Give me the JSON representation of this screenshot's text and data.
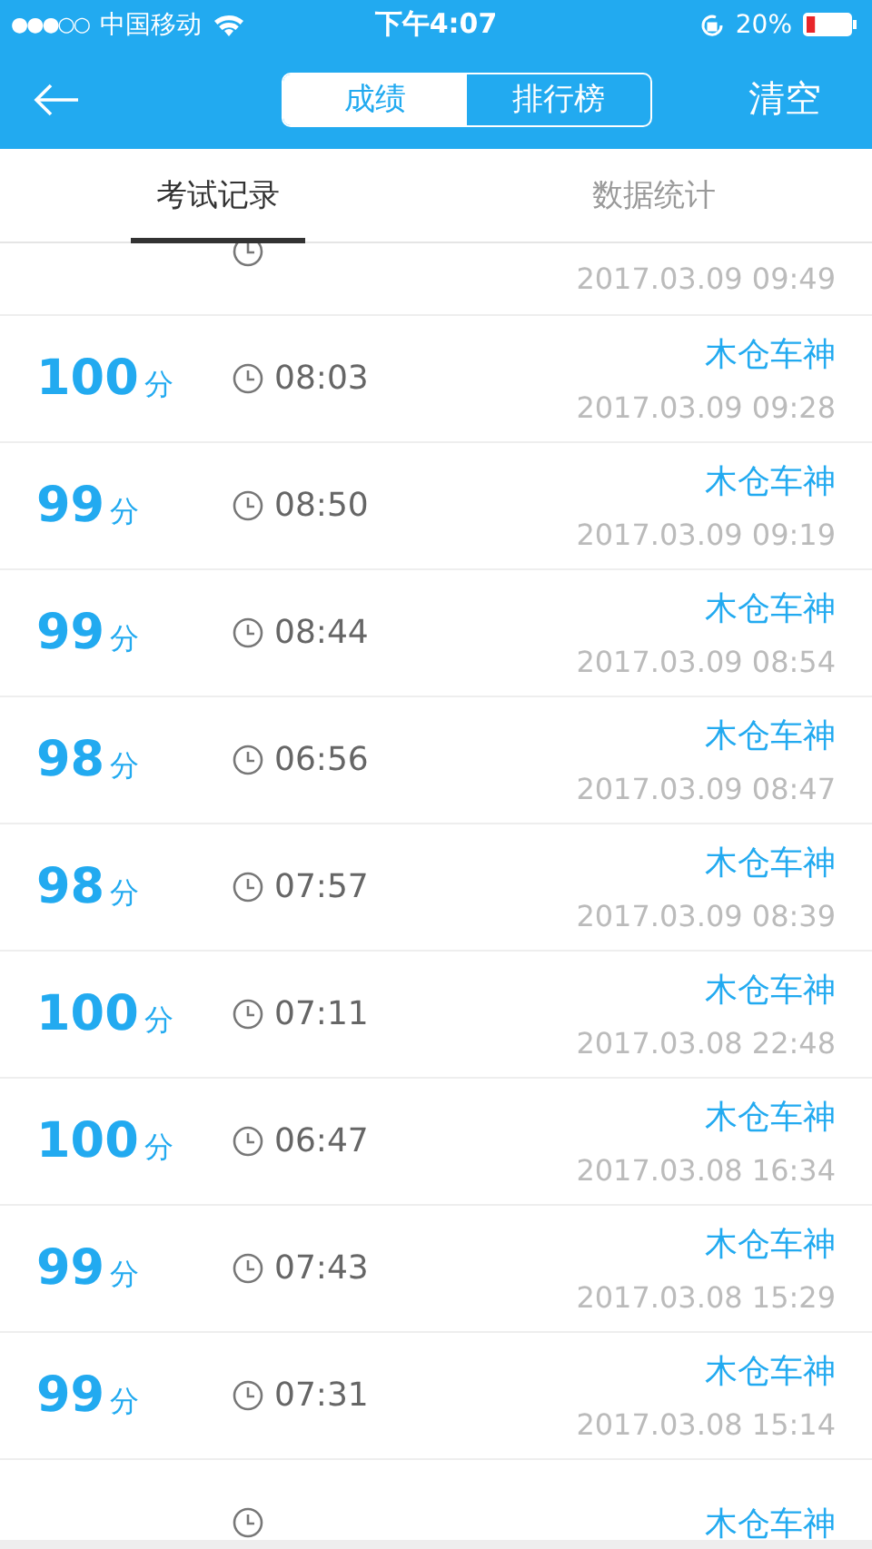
{
  "status_bar": {
    "signal": "●●●○○",
    "carrier": "中国移动",
    "time": "下午4:07",
    "battery": "20%"
  },
  "nav": {
    "segments": [
      {
        "label": "成绩",
        "selected": true
      },
      {
        "label": "排行榜",
        "selected": false
      }
    ],
    "action": "清空"
  },
  "tabs": [
    {
      "label": "考试记录",
      "selected": true
    },
    {
      "label": "数据统计",
      "selected": false
    }
  ],
  "records": [
    {
      "date": "2017.03.09 09:49"
    },
    {
      "score": "100",
      "unit": "分",
      "duration": "08:03",
      "name": "木仓车神",
      "date": "2017.03.09 09:28"
    },
    {
      "score": "99",
      "unit": "分",
      "duration": "08:50",
      "name": "木仓车神",
      "date": "2017.03.09 09:19"
    },
    {
      "score": "99",
      "unit": "分",
      "duration": "08:44",
      "name": "木仓车神",
      "date": "2017.03.09 08:54"
    },
    {
      "score": "98",
      "unit": "分",
      "duration": "06:56",
      "name": "木仓车神",
      "date": "2017.03.09 08:47"
    },
    {
      "score": "98",
      "unit": "分",
      "duration": "07:57",
      "name": "木仓车神",
      "date": "2017.03.09 08:39"
    },
    {
      "score": "100",
      "unit": "分",
      "duration": "07:11",
      "name": "木仓车神",
      "date": "2017.03.08 22:48"
    },
    {
      "score": "100",
      "unit": "分",
      "duration": "06:47",
      "name": "木仓车神",
      "date": "2017.03.08 16:34"
    },
    {
      "score": "99",
      "unit": "分",
      "duration": "07:43",
      "name": "木仓车神",
      "date": "2017.03.08 15:29"
    },
    {
      "score": "99",
      "unit": "分",
      "duration": "07:31",
      "name": "木仓车神",
      "date": "2017.03.08 15:14"
    },
    {
      "name": "木仓车神"
    }
  ]
}
